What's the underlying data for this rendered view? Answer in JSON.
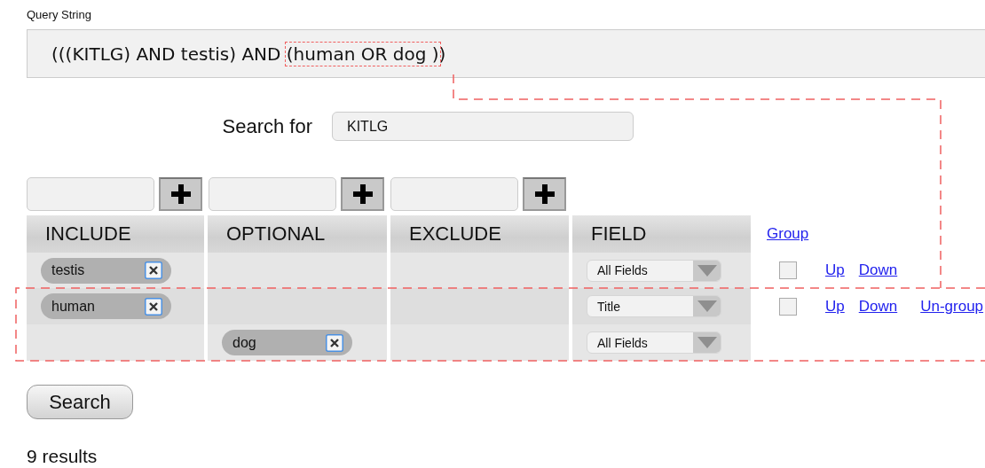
{
  "query": {
    "label": "Query String",
    "text_before": "(((KITLG) AND testis) AND ",
    "highlighted": "(human OR dog )",
    "text_after": ")"
  },
  "search_for": {
    "label": "Search for",
    "value": "KITLG"
  },
  "columns": [
    {
      "label": "INCLUDE",
      "kind": "term"
    },
    {
      "label": "OPTIONAL",
      "kind": "term"
    },
    {
      "label": "EXCLUDE",
      "kind": "term"
    },
    {
      "label": "FIELD",
      "kind": "field"
    }
  ],
  "group_link": "Group",
  "rows": [
    {
      "cells": [
        {
          "kind": "term",
          "text": "testis"
        },
        {
          "kind": "empty"
        },
        {
          "kind": "empty"
        },
        {
          "kind": "field",
          "value": "All Fields"
        }
      ],
      "checkbox": {
        "checked": false
      },
      "links": [
        "Up",
        "Down"
      ]
    },
    {
      "cells": [
        {
          "kind": "term",
          "text": "human"
        },
        {
          "kind": "empty"
        },
        {
          "kind": "empty"
        },
        {
          "kind": "field",
          "value": "Title"
        }
      ],
      "checkbox": {
        "checked": false
      },
      "links": [
        "Up",
        "Down",
        "Un-group"
      ]
    },
    {
      "cells": [
        {
          "kind": "empty"
        },
        {
          "kind": "term",
          "text": "dog"
        },
        {
          "kind": "empty"
        },
        {
          "kind": "field",
          "value": "All Fields"
        }
      ]
    }
  ],
  "search_button": "Search",
  "results": "9 results"
}
